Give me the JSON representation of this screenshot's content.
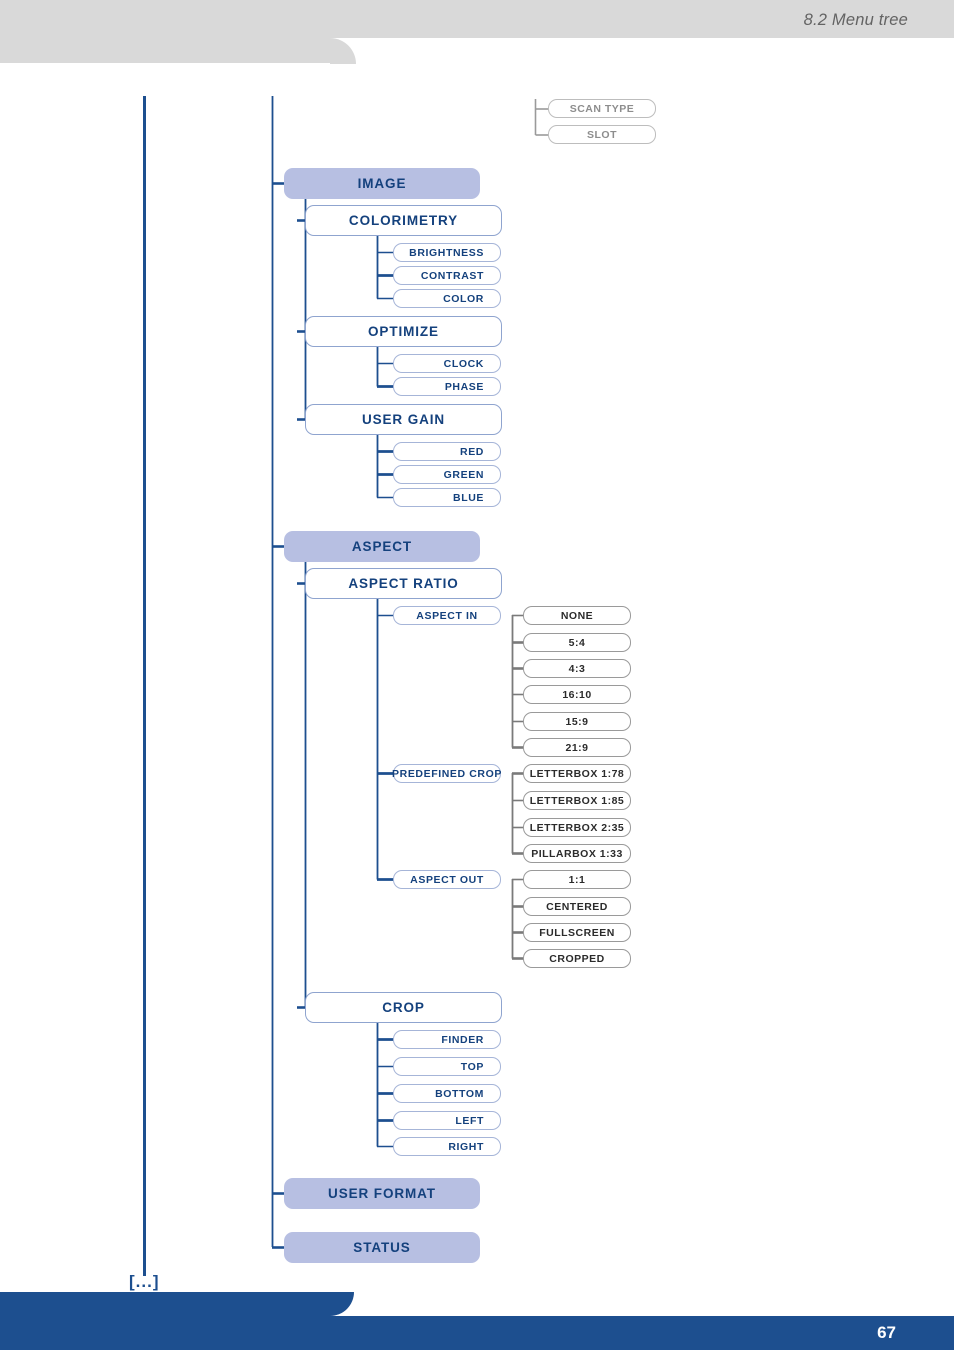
{
  "header": {
    "section_title": "8.2 Menu tree"
  },
  "footer": {
    "page_number": "67"
  },
  "tree": {
    "continuation_marker": "[...]",
    "carryover_items": [
      {
        "label": "SCAN TYPE"
      },
      {
        "label": "SLOT"
      }
    ],
    "menu": [
      {
        "label": "IMAGE",
        "level": 1,
        "children": [
          {
            "label": "COLORIMETRY",
            "level": 2,
            "children": [
              {
                "label": "BRIGHTNESS",
                "level": 3
              },
              {
                "label": "CONTRAST",
                "level": 3
              },
              {
                "label": "COLOR",
                "level": 3
              }
            ]
          },
          {
            "label": "OPTIMIZE",
            "level": 2,
            "children": [
              {
                "label": "CLOCK",
                "level": 3
              },
              {
                "label": "PHASE",
                "level": 3
              }
            ]
          },
          {
            "label": "USER GAIN",
            "level": 2,
            "children": [
              {
                "label": "RED",
                "level": 3
              },
              {
                "label": "GREEN",
                "level": 3
              },
              {
                "label": "BLUE",
                "level": 3
              }
            ]
          }
        ]
      },
      {
        "label": "ASPECT",
        "level": 1,
        "children": [
          {
            "label": "ASPECT RATIO",
            "level": 2,
            "children": [
              {
                "label": "ASPECT IN",
                "level": 3,
                "values": [
                  "NONE",
                  "5:4",
                  "4:3",
                  "16:10",
                  "15:9",
                  "21:9"
                ]
              },
              {
                "label": "PREDEFINED CROP",
                "level": 3,
                "values": [
                  "LETTERBOX 1:78",
                  "LETTERBOX 1:85",
                  "LETTERBOX 2:35",
                  "PILLARBOX 1:33"
                ]
              },
              {
                "label": "ASPECT OUT",
                "level": 3,
                "values": [
                  "1:1",
                  "CENTERED",
                  "FULLSCREEN",
                  "CROPPED"
                ]
              }
            ]
          },
          {
            "label": "CROP",
            "level": 2,
            "children": [
              {
                "label": "FINDER",
                "level": 3
              },
              {
                "label": "TOP",
                "level": 3
              },
              {
                "label": "BOTTOM",
                "level": 3
              },
              {
                "label": "LEFT",
                "level": 3
              },
              {
                "label": "RIGHT",
                "level": 3
              }
            ]
          }
        ]
      },
      {
        "label": "USER FORMAT",
        "level": 1,
        "children": []
      },
      {
        "label": "STATUS",
        "level": 1,
        "children": []
      }
    ]
  },
  "colors": {
    "brand_blue": "#1d4f8f",
    "node_fill": "#b7bfe2",
    "node_text": "#14417d",
    "header_grey": "#d9d9d9",
    "value_border": "#9a9a9a"
  }
}
